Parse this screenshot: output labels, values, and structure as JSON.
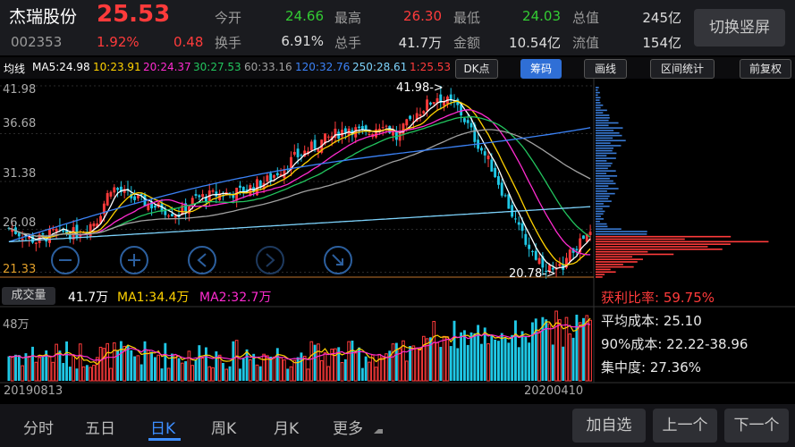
{
  "quote": {
    "name": "杰瑞股份",
    "price": "25.53",
    "code": "002353",
    "change_pct": "1.92%",
    "change": "0.48",
    "fields": [
      {
        "label": "今开",
        "value": "24.66",
        "color": "#33cc33"
      },
      {
        "label": "最高",
        "value": "26.30",
        "color": "#ff3b3b"
      },
      {
        "label": "最低",
        "value": "24.03",
        "color": "#33cc33"
      },
      {
        "label": "总值",
        "value": "245亿",
        "color": "#dddddd"
      },
      {
        "label": "换手",
        "value": "6.91%",
        "color": "#dddddd"
      },
      {
        "label": "总手",
        "value": "41.7万",
        "color": "#dddddd"
      },
      {
        "label": "金额",
        "value": "10.54亿",
        "color": "#dddddd"
      },
      {
        "label": "流值",
        "value": "154亿",
        "color": "#dddddd"
      }
    ],
    "portrait_button": "切换竖屏"
  },
  "ma_legend": {
    "title": "均线",
    "items": [
      {
        "text": "MA5:24.98",
        "color": "#ffffff"
      },
      {
        "text": "10:23.91",
        "color": "#ffd200"
      },
      {
        "text": "20:24.37",
        "color": "#ff2bd0"
      },
      {
        "text": "30:27.53",
        "color": "#22c55e"
      },
      {
        "text": "60:33.16",
        "color": "#a0a0a0"
      },
      {
        "text": "120:32.76",
        "color": "#3b82f6"
      },
      {
        "text": "250:28.61",
        "color": "#7dd3fc"
      },
      {
        "text": "1:25.53",
        "color": "#ff3b3b"
      }
    ],
    "buttons": [
      "DK点",
      "筹码",
      "画线",
      "区间统计",
      "前复权"
    ],
    "active_button": "筹码"
  },
  "price_axis": [
    "41.98",
    "36.68",
    "31.38",
    "26.08",
    "21.33"
  ],
  "chart_annotations": {
    "high": "41.98",
    "low": "20.78",
    "current_line": "21.33"
  },
  "volume": {
    "button": "成交量",
    "vol": "41.7万",
    "ma1": "MA1:34.4万",
    "ma2": "MA2:32.7万",
    "ma1_color": "#ffd200",
    "ma2_color": "#ff2bd0",
    "axis_label": "48万"
  },
  "dates": {
    "start": "20190813",
    "end": "20200410"
  },
  "chip_stats": {
    "profit_ratio": "获利比率: 59.75%",
    "avg_cost": "平均成本: 25.10",
    "cost_90": "90%成本: 22.22-38.96",
    "concentration": "集中度: 27.36%"
  },
  "period_tabs": [
    "分时",
    "五日",
    "日K",
    "周K",
    "月K",
    "更多"
  ],
  "active_period": "日K",
  "bottom_buttons": [
    "加自选",
    "上一个",
    "下一个"
  ],
  "colors": {
    "up": "#ff3b3b",
    "down": "#1fc8e6",
    "accent": "#3d8eff"
  },
  "chart_data": {
    "type": "candlestick",
    "title": "",
    "x_range": [
      "20190813",
      "20200410"
    ],
    "ylim": [
      20.78,
      41.98
    ],
    "price_ticks": [
      41.98,
      36.68,
      31.38,
      26.08,
      21.33
    ],
    "close_points": [
      [
        0,
        26.2
      ],
      [
        8,
        24.8
      ],
      [
        14,
        25.8
      ],
      [
        20,
        25.6
      ],
      [
        26,
        27.2
      ],
      [
        30,
        30.8
      ],
      [
        36,
        29.6
      ],
      [
        44,
        28.5
      ],
      [
        50,
        27.8
      ],
      [
        55,
        29.5
      ],
      [
        62,
        30.0
      ],
      [
        68,
        30.2
      ],
      [
        76,
        31.5
      ],
      [
        84,
        34.0
      ],
      [
        92,
        35.8
      ],
      [
        100,
        37.4
      ],
      [
        105,
        36.5
      ],
      [
        110,
        38.0
      ],
      [
        114,
        36.2
      ],
      [
        120,
        39.0
      ],
      [
        126,
        40.8
      ],
      [
        132,
        39.6
      ],
      [
        137,
        36.2
      ],
      [
        142,
        33.0
      ],
      [
        146,
        29.6
      ],
      [
        150,
        26.0
      ],
      [
        154,
        23.5
      ],
      [
        158,
        22.0
      ],
      [
        161,
        21.2
      ],
      [
        164,
        22.8
      ],
      [
        168,
        24.6
      ],
      [
        171,
        25.53
      ]
    ],
    "high_point": [
      127,
      41.98
    ],
    "low_point": [
      161,
      20.78
    ],
    "ma_series": [
      {
        "name": "MA5",
        "color": "#ffffff",
        "last": 24.98
      },
      {
        "name": "MA10",
        "color": "#ffd200",
        "last": 23.91
      },
      {
        "name": "MA20",
        "color": "#ff2bd0",
        "last": 24.37
      },
      {
        "name": "MA30",
        "color": "#22c55e",
        "last": 27.53
      },
      {
        "name": "MA60",
        "color": "#a0a0a0",
        "last": 33.16
      },
      {
        "name": "MA120",
        "color": "#3b82f6",
        "last": 32.76
      },
      {
        "name": "MA250",
        "color": "#7dd3fc",
        "last": 28.61
      }
    ],
    "volume_ylim": [
      0,
      48
    ],
    "volume_last": 41.7,
    "volume_ma1_last": 34.4,
    "volume_ma2_last": 32.7
  }
}
